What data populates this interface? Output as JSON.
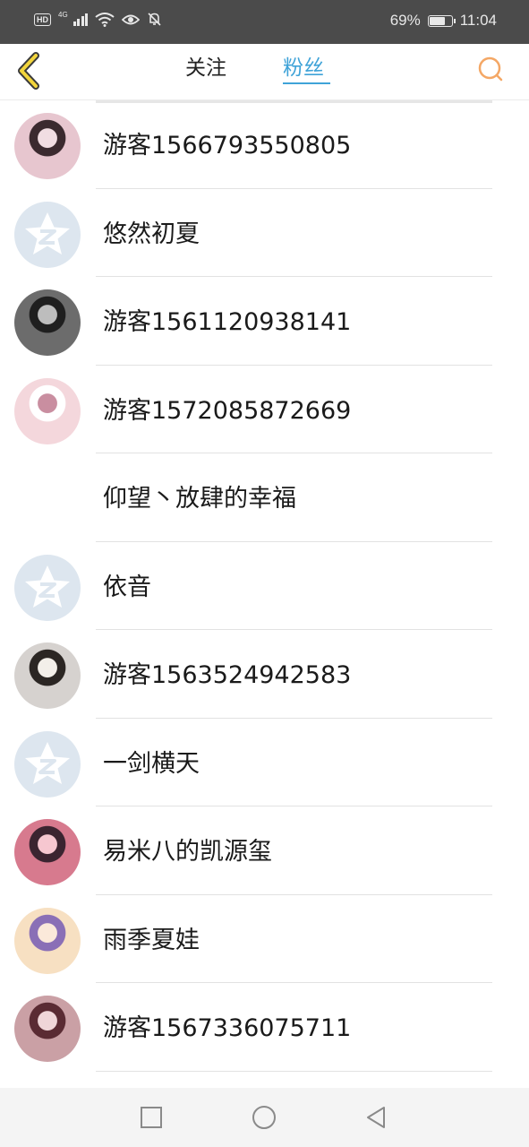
{
  "status_bar": {
    "hd": "HD",
    "network": "4G",
    "battery_percent": "69%",
    "battery_level": 0.69,
    "time": "11:04"
  },
  "header": {
    "back_icon": "chevron-left-icon",
    "tabs": [
      {
        "label": "关注",
        "active": false
      },
      {
        "label": "粉丝",
        "active": true
      }
    ],
    "search_icon": "search-icon",
    "active_color": "#3fa3d8",
    "back_color": "#f2d53c",
    "search_color": "#f4a765"
  },
  "fans": [
    {
      "name": "游客1566793550805",
      "avatar": "photo-avatar"
    },
    {
      "name": "悠然初夏",
      "avatar": "default-qq-avatar"
    },
    {
      "name": "游客1561120938141",
      "avatar": "photo-avatar"
    },
    {
      "name": "游客1572085872669",
      "avatar": "photo-avatar"
    },
    {
      "name": "仰望丶放肆的幸福",
      "avatar": "none"
    },
    {
      "name": "依音",
      "avatar": "default-qq-avatar"
    },
    {
      "name": "游客1563524942583",
      "avatar": "photo-avatar"
    },
    {
      "name": "一剑横天",
      "avatar": "default-qq-avatar"
    },
    {
      "name": "易米八的凯源玺",
      "avatar": "photo-avatar"
    },
    {
      "name": "雨季夏娃",
      "avatar": "photo-avatar"
    },
    {
      "name": "游客1567336075711",
      "avatar": "photo-avatar"
    }
  ],
  "nav_bar": {
    "recents_icon": "square-icon",
    "home_icon": "circle-icon",
    "back_icon": "triangle-back-icon"
  }
}
